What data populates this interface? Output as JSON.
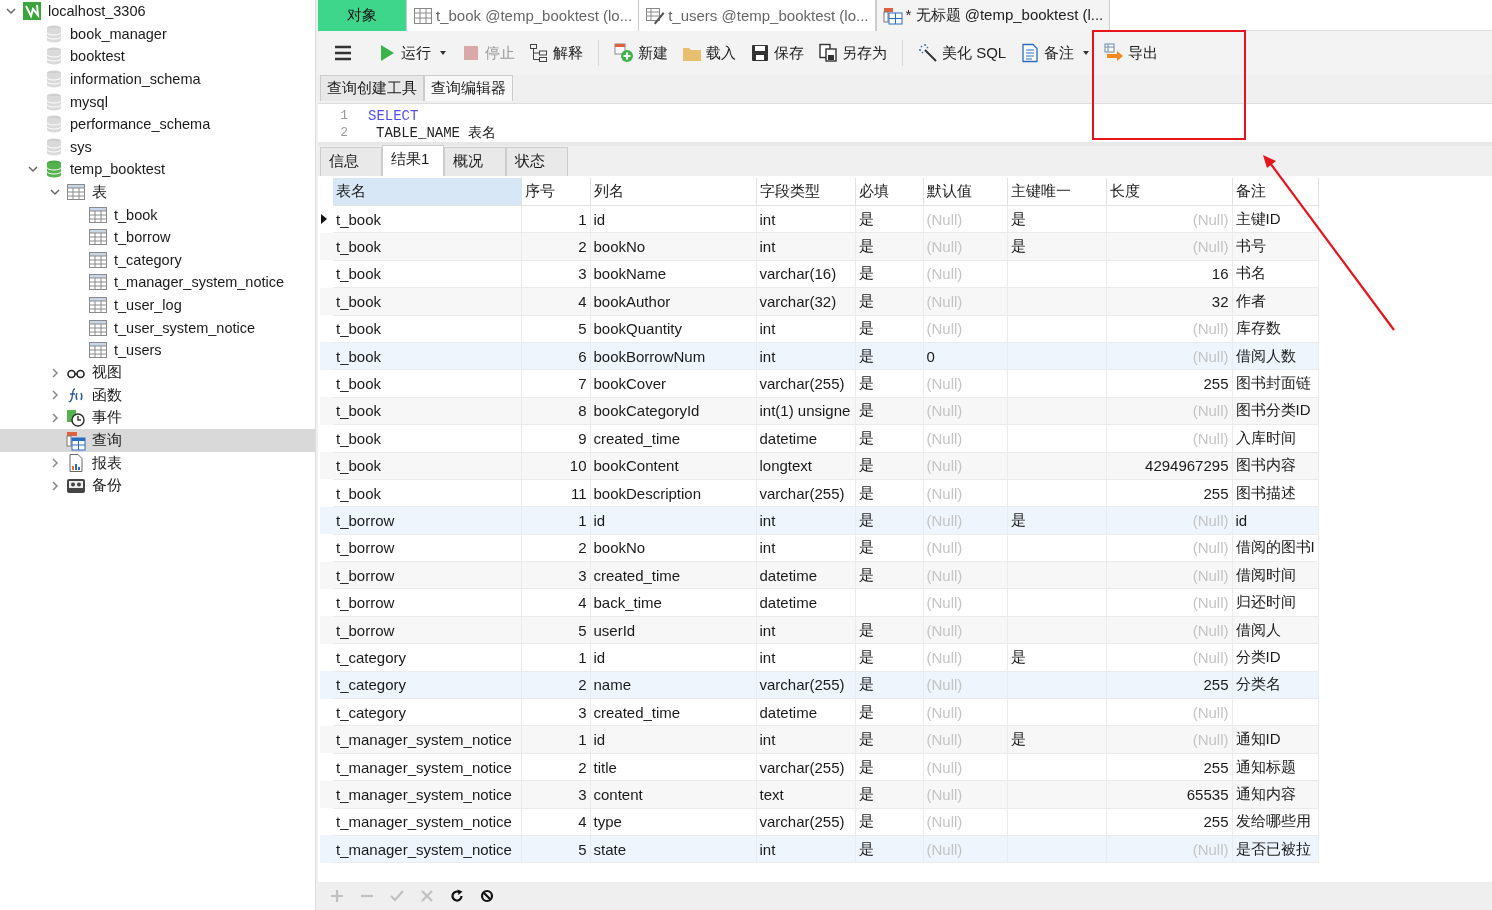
{
  "sidebar": {
    "tree": [
      {
        "label": "localhost_3306",
        "kind": "connection",
        "expanded": true,
        "selected": false,
        "children": [
          {
            "label": "book_manager",
            "kind": "database",
            "selected": false
          },
          {
            "label": "booktest",
            "kind": "database",
            "selected": false
          },
          {
            "label": "information_schema",
            "kind": "database",
            "selected": false
          },
          {
            "label": "mysql",
            "kind": "database",
            "selected": false
          },
          {
            "label": "performance_schema",
            "kind": "database",
            "selected": false
          },
          {
            "label": "sys",
            "kind": "database",
            "selected": false
          },
          {
            "label": "temp_booktest",
            "kind": "database_open",
            "expanded": true,
            "selected": false,
            "children": [
              {
                "label": "表",
                "kind": "tables",
                "expanded": true,
                "selected": false,
                "children": [
                  {
                    "label": "t_book",
                    "kind": "table",
                    "selected": false
                  },
                  {
                    "label": "t_borrow",
                    "kind": "table",
                    "selected": false
                  },
                  {
                    "label": "t_category",
                    "kind": "table",
                    "selected": false
                  },
                  {
                    "label": "t_manager_system_notice",
                    "kind": "table",
                    "selected": false
                  },
                  {
                    "label": "t_user_log",
                    "kind": "table",
                    "selected": false
                  },
                  {
                    "label": "t_user_system_notice",
                    "kind": "table",
                    "selected": false
                  },
                  {
                    "label": "t_users",
                    "kind": "table",
                    "selected": false
                  }
                ]
              },
              {
                "label": "视图",
                "kind": "views",
                "expanded": false,
                "selected": false
              },
              {
                "label": "函数",
                "kind": "functions",
                "expanded": false,
                "selected": false
              },
              {
                "label": "事件",
                "kind": "events",
                "expanded": false,
                "selected": false
              },
              {
                "label": "查询",
                "kind": "queries",
                "selected": true
              },
              {
                "label": "报表",
                "kind": "reports",
                "expanded": false,
                "selected": false
              },
              {
                "label": "备份",
                "kind": "backups",
                "expanded": false,
                "selected": false
              }
            ]
          }
        ]
      }
    ]
  },
  "tabs": [
    {
      "label": "对象",
      "kind": "objects",
      "selected": false
    },
    {
      "label": "t_book @temp_booktest (lo...",
      "kind": "table",
      "selected": false
    },
    {
      "label": "t_users @temp_booktest (lo...",
      "kind": "design",
      "selected": false
    },
    {
      "label": "* 无标题 @temp_booktest (l...",
      "kind": "query",
      "selected": true
    }
  ],
  "toolbar": [
    {
      "kind": "menu"
    },
    {
      "kind": "run",
      "label": "运行",
      "dropdown": true,
      "disabled": false
    },
    {
      "kind": "stop",
      "label": "停止",
      "disabled": true
    },
    {
      "kind": "explain",
      "label": "解释",
      "disabled": false
    },
    {
      "kind": "separator"
    },
    {
      "kind": "new",
      "label": "新建",
      "disabled": false
    },
    {
      "kind": "load",
      "label": "载入",
      "disabled": false
    },
    {
      "kind": "save",
      "label": "保存",
      "disabled": false
    },
    {
      "kind": "save_as",
      "label": "另存为",
      "disabled": false
    },
    {
      "kind": "separator"
    },
    {
      "kind": "beautify",
      "label": "美化 SQL",
      "disabled": false
    },
    {
      "kind": "comment",
      "label": "备注",
      "dropdown": true,
      "disabled": false
    },
    {
      "kind": "export",
      "label": "导出",
      "disabled": false
    }
  ],
  "editor_tabs": [
    {
      "label": "查询创建工具",
      "selected": false
    },
    {
      "label": "查询编辑器",
      "selected": true
    }
  ],
  "editor": {
    "lines": [
      {
        "number": "1",
        "code": "SELECT"
      },
      {
        "number": "2",
        "code": "TABLE_NAME 表名"
      }
    ]
  },
  "result_tabs": [
    {
      "label": "信息",
      "selected": false
    },
    {
      "label": "结果1",
      "selected": true
    },
    {
      "label": "概况",
      "selected": false
    },
    {
      "label": "状态",
      "selected": false
    }
  ],
  "table": {
    "columns": [
      {
        "label": "表名",
        "selected": true
      },
      {
        "label": "序号",
        "selected": false
      },
      {
        "label": "列名",
        "selected": false
      },
      {
        "label": "字段类型",
        "selected": false
      },
      {
        "label": "必填",
        "selected": false
      },
      {
        "label": "默认值",
        "selected": false
      },
      {
        "label": "主键唯一",
        "selected": false
      },
      {
        "label": "长度",
        "selected": false
      },
      {
        "label": "备注",
        "selected": false
      }
    ],
    "rows": [
      {
        "current": true,
        "tinted": false,
        "table": "t_book",
        "no": "1",
        "column": "id",
        "type": "int",
        "required": "是",
        "default": "(Null)",
        "default_null": true,
        "key": "是",
        "length": "(Null)",
        "length_null": true,
        "comment": "主键ID"
      },
      {
        "current": false,
        "tinted": false,
        "table": "t_book",
        "no": "2",
        "column": "bookNo",
        "type": "int",
        "required": "是",
        "default": "(Null)",
        "default_null": true,
        "key": "是",
        "length": "(Null)",
        "length_null": true,
        "comment": "书号"
      },
      {
        "current": false,
        "tinted": false,
        "table": "t_book",
        "no": "3",
        "column": "bookName",
        "type": "varchar(16)",
        "required": "是",
        "default": "(Null)",
        "default_null": true,
        "length": "16",
        "length_null": false,
        "comment": "书名"
      },
      {
        "current": false,
        "tinted": false,
        "table": "t_book",
        "no": "4",
        "column": "bookAuthor",
        "type": "varchar(32)",
        "required": "是",
        "default": "(Null)",
        "default_null": true,
        "length": "32",
        "length_null": false,
        "comment": "作者"
      },
      {
        "current": false,
        "tinted": false,
        "table": "t_book",
        "no": "5",
        "column": "bookQuantity",
        "type": "int",
        "required": "是",
        "default": "(Null)",
        "default_null": true,
        "length": "(Null)",
        "length_null": true,
        "comment": "库存数"
      },
      {
        "current": false,
        "tinted": true,
        "table": "t_book",
        "no": "6",
        "column": "bookBorrowNum",
        "type": "int",
        "required": "是",
        "default": "0",
        "default_null": false,
        "length": "(Null)",
        "length_null": true,
        "comment": "借阅人数"
      },
      {
        "current": false,
        "tinted": false,
        "table": "t_book",
        "no": "7",
        "column": "bookCover",
        "type": "varchar(255)",
        "required": "是",
        "default": "(Null)",
        "default_null": true,
        "length": "255",
        "length_null": false,
        "comment": "图书封面链"
      },
      {
        "current": false,
        "tinted": false,
        "table": "t_book",
        "no": "8",
        "column": "bookCategoryId",
        "type": "int(1) unsigne",
        "required": "是",
        "default": "(Null)",
        "default_null": true,
        "length": "(Null)",
        "length_null": true,
        "comment": "图书分类ID"
      },
      {
        "current": false,
        "tinted": false,
        "table": "t_book",
        "no": "9",
        "column": "created_time",
        "type": "datetime",
        "required": "是",
        "default": "(Null)",
        "default_null": true,
        "length": "(Null)",
        "length_null": true,
        "comment": "入库时间"
      },
      {
        "current": false,
        "tinted": false,
        "table": "t_book",
        "no": "10",
        "column": "bookContent",
        "type": "longtext",
        "required": "是",
        "default": "(Null)",
        "default_null": true,
        "length": "4294967295",
        "length_null": false,
        "comment": "图书内容"
      },
      {
        "current": false,
        "tinted": false,
        "table": "t_book",
        "no": "11",
        "column": "bookDescription",
        "type": "varchar(255)",
        "required": "是",
        "default": "(Null)",
        "default_null": true,
        "length": "255",
        "length_null": false,
        "comment": "图书描述"
      },
      {
        "current": false,
        "tinted": true,
        "table": "t_borrow",
        "no": "1",
        "column": "id",
        "type": "int",
        "required": "是",
        "default": "(Null)",
        "default_null": true,
        "key": "是",
        "length": "(Null)",
        "length_null": true,
        "comment": "id"
      },
      {
        "current": false,
        "tinted": false,
        "table": "t_borrow",
        "no": "2",
        "column": "bookNo",
        "type": "int",
        "required": "是",
        "default": "(Null)",
        "default_null": true,
        "length": "(Null)",
        "length_null": true,
        "comment": "借阅的图书I"
      },
      {
        "current": false,
        "tinted": false,
        "table": "t_borrow",
        "no": "3",
        "column": "created_time",
        "type": "datetime",
        "required": "是",
        "default": "(Null)",
        "default_null": true,
        "length": "(Null)",
        "length_null": true,
        "comment": "借阅时间"
      },
      {
        "current": false,
        "tinted": false,
        "table": "t_borrow",
        "no": "4",
        "column": "back_time",
        "type": "datetime",
        "default": "(Null)",
        "default_null": true,
        "length": "(Null)",
        "length_null": true,
        "comment": "归还时间"
      },
      {
        "current": false,
        "tinted": false,
        "table": "t_borrow",
        "no": "5",
        "column": "userId",
        "type": "int",
        "required": "是",
        "default": "(Null)",
        "default_null": true,
        "length": "(Null)",
        "length_null": true,
        "comment": "借阅人"
      },
      {
        "current": false,
        "tinted": false,
        "table": "t_category",
        "no": "1",
        "column": "id",
        "type": "int",
        "required": "是",
        "default": "(Null)",
        "default_null": true,
        "key": "是",
        "length": "(Null)",
        "length_null": true,
        "comment": "分类ID"
      },
      {
        "current": false,
        "tinted": true,
        "table": "t_category",
        "no": "2",
        "column": "name",
        "type": "varchar(255)",
        "required": "是",
        "default": "(Null)",
        "default_null": true,
        "length": "255",
        "length_null": false,
        "comment": "分类名"
      },
      {
        "current": false,
        "tinted": false,
        "table": "t_category",
        "no": "3",
        "column": "created_time",
        "type": "datetime",
        "required": "是",
        "default": "(Null)",
        "default_null": true,
        "length": "(Null)",
        "length_null": true
      },
      {
        "current": false,
        "tinted": false,
        "table": "t_manager_system_notice",
        "no": "1",
        "column": "id",
        "type": "int",
        "required": "是",
        "default": "(Null)",
        "default_null": true,
        "key": "是",
        "length": "(Null)",
        "length_null": true,
        "comment": "通知ID"
      },
      {
        "current": false,
        "tinted": false,
        "table": "t_manager_system_notice",
        "no": "2",
        "column": "title",
        "type": "varchar(255)",
        "required": "是",
        "default": "(Null)",
        "default_null": true,
        "length": "255",
        "length_null": false,
        "comment": "通知标题"
      },
      {
        "current": false,
        "tinted": false,
        "table": "t_manager_system_notice",
        "no": "3",
        "column": "content",
        "type": "text",
        "required": "是",
        "default": "(Null)",
        "default_null": true,
        "length": "65535",
        "length_null": false,
        "comment": "通知内容"
      },
      {
        "current": false,
        "tinted": false,
        "table": "t_manager_system_notice",
        "no": "4",
        "column": "type",
        "type": "varchar(255)",
        "required": "是",
        "default": "(Null)",
        "default_null": true,
        "length": "255",
        "length_null": false,
        "comment": "发给哪些用"
      },
      {
        "current": false,
        "tinted": true,
        "table": "t_manager_system_notice",
        "no": "5",
        "column": "state",
        "type": "int",
        "required": "是",
        "default": "(Null)",
        "default_null": true,
        "length": "(Null)",
        "length_null": true,
        "comment": "是否已被拉"
      }
    ]
  },
  "bottom_bar": [
    {
      "kind": "add",
      "disabled": true
    },
    {
      "kind": "remove",
      "disabled": true
    },
    {
      "kind": "apply",
      "disabled": true
    },
    {
      "kind": "discard",
      "disabled": true
    },
    {
      "kind": "refresh",
      "disabled": false
    },
    {
      "kind": "stop",
      "disabled": false
    }
  ],
  "annotations": {
    "highlight_box": true,
    "arrow": true
  }
}
